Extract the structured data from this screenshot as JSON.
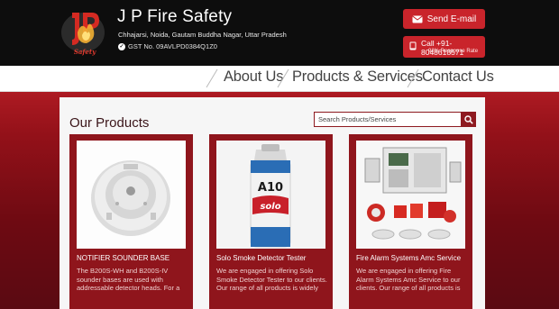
{
  "header": {
    "title": "J P Fire Safety",
    "address": "Chhajarsi, Noida, Gautam Buddha Nagar, Uttar Pradesh",
    "gst": "GST No. 09AVLPD0384Q1Z0",
    "logo_text": "JP Fire Safety",
    "email_label": "Send E-mail",
    "call_label": "Call +91-8048618571",
    "response_rate": "92% Response Rate"
  },
  "nav": {
    "items": [
      {
        "label": "About Us"
      },
      {
        "label": "Products & Services"
      },
      {
        "label": "Contact Us"
      }
    ]
  },
  "main": {
    "title": "Our Products",
    "search_placeholder": "Search Products/Services"
  },
  "products": [
    {
      "title": "NOTIFIER SOUNDER BASE",
      "description": "The B200S-WH and B200S-IV sounder bases are used with addressable detector heads. For a"
    },
    {
      "title": "Solo Smoke Detector Tester",
      "description": "We are engaged in offering Solo Smoke Detector Tester to our clients. Our range of all products is widely"
    },
    {
      "title": "Fire Alarm Systems Amc Service",
      "description": "We are engaged in offering Fire Alarm Systems Amc Service to our clients. Our range of all products is"
    }
  ],
  "colors": {
    "accent": "#c9242b",
    "band": "#931119",
    "card": "#8f151c",
    "header_bg": "#0d0d0d"
  }
}
